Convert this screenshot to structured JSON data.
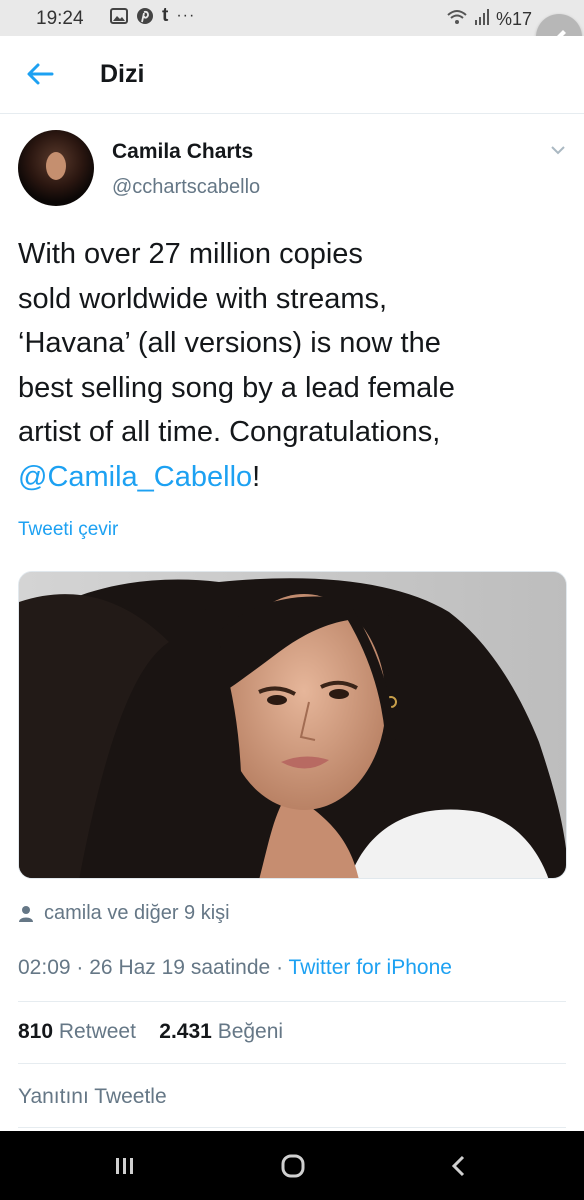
{
  "status_bar": {
    "time": "19:24",
    "left_icons": [
      "image-icon",
      "pinterest-icon"
    ],
    "tumblr_letter": "t",
    "more": "···",
    "battery_text": "%17"
  },
  "header": {
    "title": "Dizi"
  },
  "tweet": {
    "display_name": "Camila Charts",
    "handle": "@cchartscabello",
    "text_lines": [
      "With over 27 million copies",
      "sold worldwide with streams,",
      "‘Havana’ (all versions) is now the",
      "best selling song by a lead female",
      "artist of all time. Congratulations,"
    ],
    "mention": "@Camila_Cabello",
    "mention_suffix": "!",
    "translate_label": "Tweeti çevir",
    "tagged_people": "camila ve diğer 9 kişi",
    "time": "02:09",
    "date": "26 Haz 19 saatinde",
    "separator": "·",
    "source": "Twitter for iPhone",
    "retweet_count": "810",
    "retweet_label": "Retweet",
    "like_count": "2.431",
    "like_label": "Beğeni",
    "reply_label": "Yanıtını Tweetle"
  },
  "colors": {
    "twitter_blue": "#1da1f2",
    "secondary_text": "#657786",
    "primary_text": "#14171a"
  }
}
